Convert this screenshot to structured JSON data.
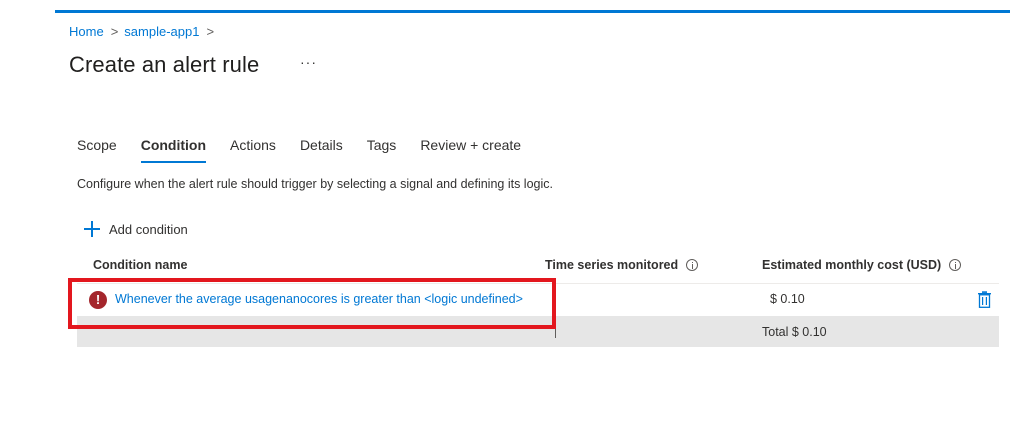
{
  "breadcrumb": {
    "items": [
      "Home",
      "sample-app1"
    ],
    "separator": ">"
  },
  "page": {
    "title": "Create an alert rule",
    "more_label": "···"
  },
  "tabs": [
    {
      "label": "Scope",
      "active": false
    },
    {
      "label": "Condition",
      "active": true
    },
    {
      "label": "Actions",
      "active": false
    },
    {
      "label": "Details",
      "active": false
    },
    {
      "label": "Tags",
      "active": false
    },
    {
      "label": "Review + create",
      "active": false
    }
  ],
  "description": "Configure when the alert rule should trigger by selecting a signal and defining its logic.",
  "add_condition": {
    "label": "Add condition",
    "icon": "plus-icon"
  },
  "table": {
    "columns": {
      "name": "Condition name",
      "series": "Time series monitored",
      "cost": "Estimated monthly cost (USD)"
    },
    "rows": [
      {
        "status_icon": "error-icon",
        "status_glyph": "!",
        "name": "Whenever the average usagenanocores is greater than <logic undefined>",
        "series": "",
        "cost": "$ 0.10",
        "action_icon": "delete-icon"
      }
    ],
    "total": "Total $ 0.10"
  },
  "colors": {
    "accent": "#0078d4",
    "error": "#a4262c",
    "highlight": "#e3171e",
    "total_row_bg": "#e6e6e6"
  }
}
